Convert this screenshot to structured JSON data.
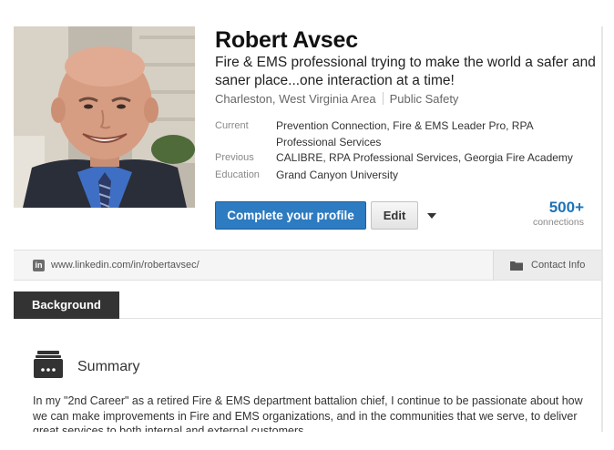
{
  "profile": {
    "name": "Robert Avsec",
    "headline": "Fire & EMS professional trying to make the world a safer and saner place...one interaction at a time!",
    "location": "Charleston, West Virginia Area",
    "industry": "Public Safety",
    "current_label": "Current",
    "current_value": "Prevention Connection, Fire & EMS Leader Pro, RPA Professional Services",
    "previous_label": "Previous",
    "previous_value": "CALIBRE, RPA Professional Services, Georgia Fire Academy",
    "education_label": "Education",
    "education_value": "Grand Canyon University"
  },
  "actions": {
    "complete_profile_label": "Complete your profile",
    "edit_label": "Edit",
    "connections_count": "500+",
    "connections_label": "connections"
  },
  "urlbar": {
    "icon_text": "in",
    "url": "www.linkedin.com/in/robertavsec/",
    "contact_label": "Contact Info"
  },
  "background": {
    "tab_label": "Background",
    "summary_title": "Summary",
    "summary_text": "In my \"2nd Career\" as a retired Fire & EMS department battalion chief, I continue to be passionate about how we can make improvements in Fire and EMS organizations, and in the communities that we serve, to deliver great services to both internal and external customers."
  },
  "colors": {
    "primary_button": "#2d7bc1",
    "connections": "#1f74b6",
    "background_tab": "#333333"
  },
  "icons": {
    "linkedin": "linkedin-icon",
    "contact": "folder-icon",
    "summary": "summary-card-icon",
    "dropdown": "caret-down-icon"
  }
}
